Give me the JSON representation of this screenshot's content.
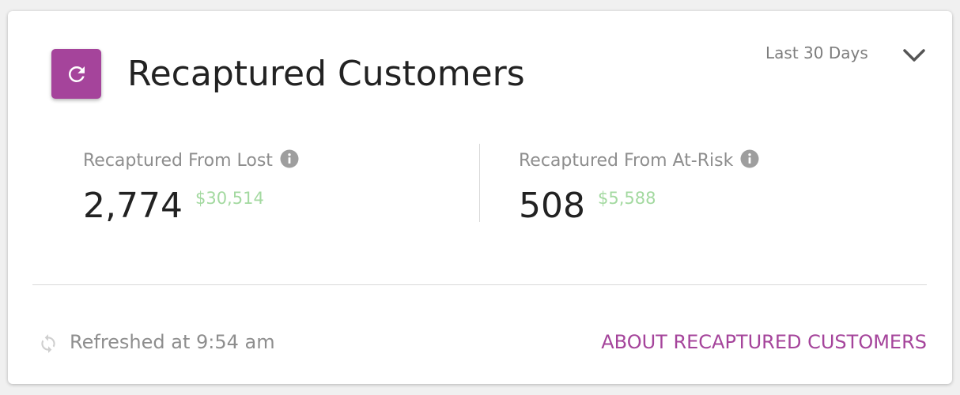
{
  "card": {
    "title": "Recaptured Customers",
    "icon": "refresh-icon",
    "accent_color": "#a5449b"
  },
  "period_selector": {
    "selected": "Last 30 Days",
    "icon": "chevron-down-icon"
  },
  "stats": [
    {
      "label": "Recaptured From Lost",
      "value": "2,774",
      "amount": "$30,514",
      "info_icon": "info-icon"
    },
    {
      "label": "Recaptured From At-Risk",
      "value": "508",
      "amount": "$5,588",
      "info_icon": "info-icon"
    }
  ],
  "footer": {
    "refreshed_text": "Refreshed at 9:54 am",
    "about_link": "ABOUT RECAPTURED CUSTOMERS"
  },
  "colors": {
    "amount_green": "#a3d9a0",
    "muted_text": "#8e8e8e"
  }
}
